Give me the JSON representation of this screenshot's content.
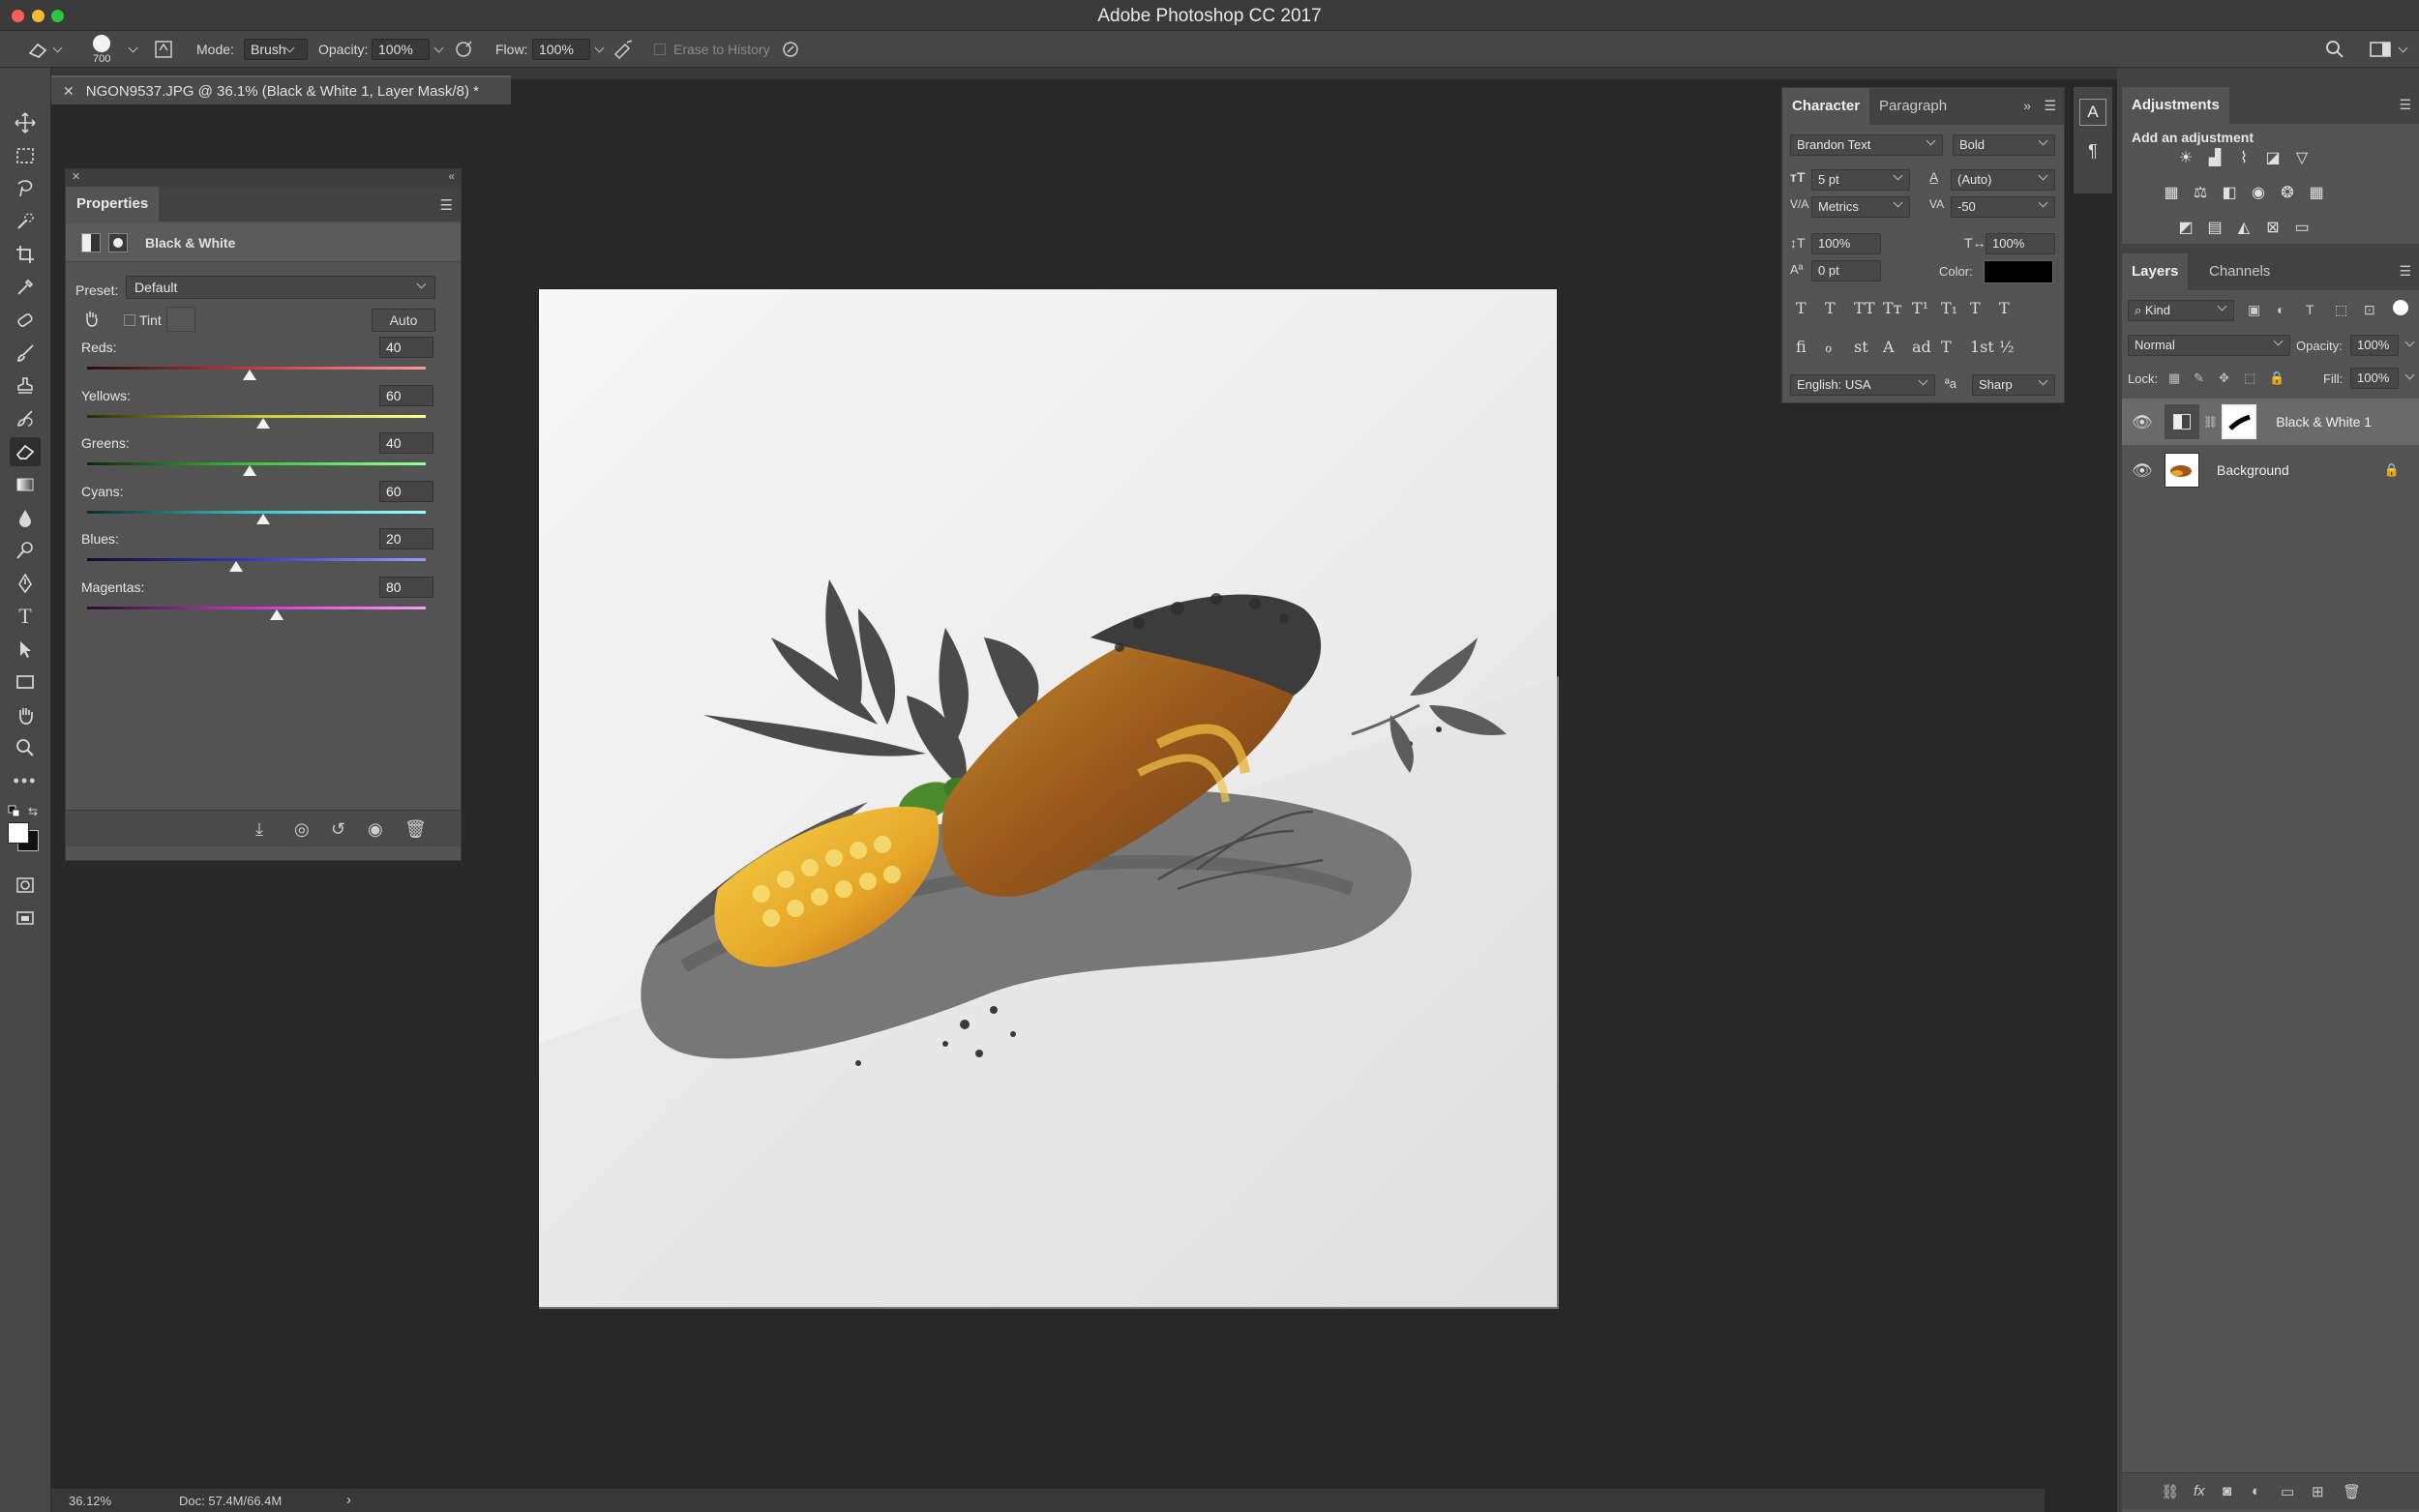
{
  "window": {
    "title": "Adobe Photoshop CC 2017"
  },
  "options_bar": {
    "brush_size": "700",
    "mode_label": "Mode:",
    "mode_value": "Brush",
    "opacity_label": "Opacity:",
    "opacity_value": "100%",
    "flow_label": "Flow:",
    "flow_value": "100%",
    "erase_to_history": "Erase to History"
  },
  "document": {
    "tab_title": "NGON9537.JPG @ 36.1% (Black & White 1, Layer Mask/8) *",
    "zoom": "36.12%",
    "doc_size": "Doc: 57.4M/66.4M"
  },
  "properties": {
    "tab": "Properties",
    "adjustment_name": "Black & White",
    "preset_label": "Preset:",
    "preset_value": "Default",
    "tint_label": "Tint",
    "auto_label": "Auto",
    "sliders": [
      {
        "name": "Reds:",
        "value": "40",
        "fraction": 0.48,
        "gradient": "linear-gradient(90deg,#2a0d0d,#c83a3a,#ff9a9a)"
      },
      {
        "name": "Yellows:",
        "value": "60",
        "fraction": 0.52,
        "gradient": "linear-gradient(90deg,#2a2a08,#c8c832,#ffff8a)"
      },
      {
        "name": "Greens:",
        "value": "40",
        "fraction": 0.48,
        "gradient": "linear-gradient(90deg,#0d2a0d,#3ac83a,#9aff9a)"
      },
      {
        "name": "Cyans:",
        "value": "60",
        "fraction": 0.52,
        "gradient": "linear-gradient(90deg,#0d2a2a,#3ac8c8,#9affff)"
      },
      {
        "name": "Blues:",
        "value": "20",
        "fraction": 0.44,
        "gradient": "linear-gradient(90deg,#0d0d2a,#3a3ac8,#9a9aff)"
      },
      {
        "name": "Magentas:",
        "value": "80",
        "fraction": 0.56,
        "gradient": "linear-gradient(90deg,#2a0d2a,#c83ac8,#ff9aff)"
      }
    ]
  },
  "character": {
    "tab_character": "Character",
    "tab_paragraph": "Paragraph",
    "font_family": "Brandon Text",
    "font_style": "Bold",
    "font_size": "5 pt",
    "leading": "(Auto)",
    "kerning": "Metrics",
    "tracking": "-50",
    "vertical_scale": "100%",
    "horizontal_scale": "100%",
    "baseline_shift": "0 pt",
    "color_label": "Color:",
    "language": "English: USA",
    "antialias": "Sharp",
    "aa_label": "ªa",
    "style_glyphs": [
      "T",
      "T",
      "TT",
      "Tт",
      "T¹",
      "T₁",
      "T",
      "T"
    ],
    "opentype_glyphs": [
      "fi",
      "ℴ",
      "st",
      "A",
      "ad",
      "T",
      "1st",
      "½"
    ]
  },
  "adjustments": {
    "tab": "Adjustments",
    "subtitle": "Add an adjustment"
  },
  "layers_panel": {
    "tab_layers": "Layers",
    "tab_channels": "Channels",
    "kind_label": "Kind",
    "blend_mode": "Normal",
    "opacity_label": "Opacity:",
    "opacity_value": "100%",
    "lock_label": "Lock:",
    "fill_label": "Fill:",
    "fill_value": "100%",
    "layers": [
      {
        "name": "Black & White 1"
      },
      {
        "name": "Background"
      }
    ]
  }
}
